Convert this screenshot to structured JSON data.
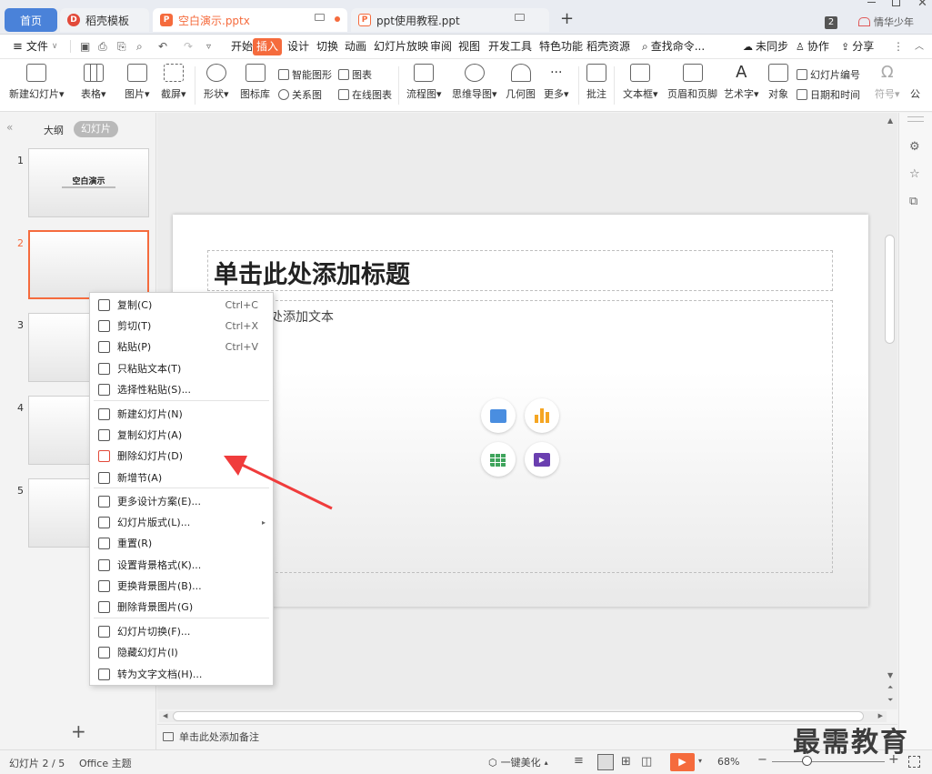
{
  "tabs": {
    "home": "首页",
    "template": "稻壳模板",
    "doc1": "空白演示.pptx",
    "doc2": "ppt使用教程.ppt",
    "add": "+",
    "badge": "2",
    "user": "情华少年"
  },
  "menu": {
    "file": "文件",
    "items": [
      "开始",
      "插入",
      "设计",
      "切换",
      "动画",
      "幻灯片放映",
      "审阅",
      "视图",
      "开发工具",
      "特色功能",
      "稻壳资源"
    ],
    "active_index": 1,
    "search": "查找命令...",
    "unsynced": "未同步",
    "collab": "协作",
    "share": "分享"
  },
  "ribbon": {
    "new_slide": "新建幻灯片",
    "table": "表格",
    "image": "图片",
    "screenshot": "截屏",
    "shape": "形状",
    "icon_lib": "图标库",
    "smart_art": "智能图形",
    "relation": "关系图",
    "chart": "图表",
    "online_chart": "在线图表",
    "flowchart": "流程图",
    "mindmap": "思维导图",
    "geometry": "几何图",
    "more": "更多",
    "comment": "批注",
    "textbox": "文本框",
    "header_footer": "页眉和页脚",
    "wordart": "艺术字",
    "object": "对象",
    "slide_number": "幻灯片编号",
    "datetime": "日期和时间",
    "symbol": "符号",
    "formula": "公"
  },
  "panel": {
    "outline": "大纲",
    "slides": "幻灯片",
    "numbers": [
      "1",
      "2",
      "3",
      "4",
      "5"
    ],
    "thumb1_title": "空白演示",
    "add": "+"
  },
  "slide": {
    "title_placeholder": "单击此处添加标题",
    "body_placeholder": "处添加文本"
  },
  "context_menu": {
    "items": [
      {
        "label": "复制(C)",
        "shortcut": "Ctrl+C",
        "icon": "copy-icon"
      },
      {
        "label": "剪切(T)",
        "shortcut": "Ctrl+X",
        "icon": "cut-icon"
      },
      {
        "label": "粘贴(P)",
        "shortcut": "Ctrl+V",
        "icon": "paste-icon"
      },
      {
        "label": "只粘贴文本(T)",
        "shortcut": "",
        "icon": "paste-text-icon"
      },
      {
        "label": "选择性粘贴(S)...",
        "shortcut": "",
        "icon": "paste-special-icon"
      },
      {
        "label": "新建幻灯片(N)",
        "shortcut": "",
        "icon": "new-slide-icon"
      },
      {
        "label": "复制幻灯片(A)",
        "shortcut": "",
        "icon": "duplicate-slide-icon"
      },
      {
        "label": "删除幻灯片(D)",
        "shortcut": "",
        "icon": "delete-slide-icon"
      },
      {
        "label": "新增节(A)",
        "shortcut": "",
        "icon": "new-section-icon"
      },
      {
        "label": "更多设计方案(E)...",
        "shortcut": "",
        "icon": "design-icon"
      },
      {
        "label": "幻灯片版式(L)...",
        "shortcut": "",
        "icon": "layout-icon"
      },
      {
        "label": "重置(R)",
        "shortcut": "",
        "icon": "reset-icon"
      },
      {
        "label": "设置背景格式(K)...",
        "shortcut": "",
        "icon": "background-icon"
      },
      {
        "label": "更换背景图片(B)...",
        "shortcut": "",
        "icon": "change-bg-image-icon"
      },
      {
        "label": "删除背景图片(G)",
        "shortcut": "",
        "icon": "delete-bg-image-icon"
      },
      {
        "label": "幻灯片切换(F)...",
        "shortcut": "",
        "icon": "transition-icon"
      },
      {
        "label": "隐藏幻灯片(I)",
        "shortcut": "",
        "icon": "hide-slide-icon"
      },
      {
        "label": "转为文字文档(H)...",
        "shortcut": "",
        "icon": "to-doc-icon"
      }
    ]
  },
  "notes": "单击此处添加备注",
  "status": {
    "slide_count": "幻灯片 2 / 5",
    "theme": "Office 主题",
    "beautify": "一键美化",
    "zoom": "68%"
  },
  "watermark": "最需教育",
  "colors": {
    "accent": "#f56b3d",
    "home_tab": "#4a82d9",
    "arrow": "#f03c3c"
  }
}
